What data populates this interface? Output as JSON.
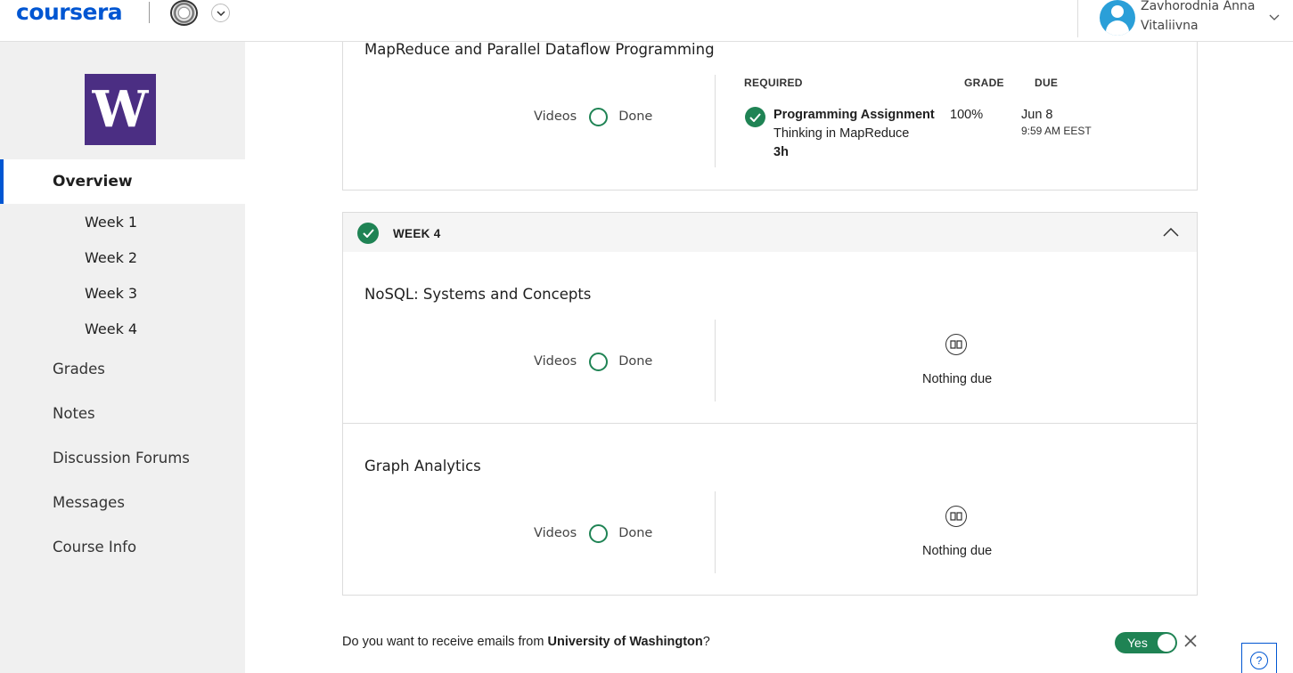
{
  "header": {
    "logo_text": "coursera",
    "user_name_line1": "Zavhorodnia Anna",
    "user_name_line2": "Vitaliivna"
  },
  "sidebar": {
    "logo_letter": "W",
    "overview": "Overview",
    "weeks": [
      "Week 1",
      "Week 2",
      "Week 3",
      "Week 4"
    ],
    "items": [
      "Grades",
      "Notes",
      "Discussion Forums",
      "Messages",
      "Course Info"
    ]
  },
  "week3_card": {
    "section_title": "MapReduce and Parallel Dataflow Programming",
    "videos_label": "Videos",
    "done_label": "Done",
    "col_required": "REQUIRED",
    "col_grade": "GRADE",
    "col_due": "DUE",
    "assignment": {
      "type": "Programming Assignment",
      "name": "Thinking in MapReduce",
      "duration": "3h",
      "grade": "100%",
      "due_date": "Jun 8",
      "due_time": "9:59 AM EEST"
    }
  },
  "week4_card": {
    "label": "WEEK 4",
    "sections": [
      {
        "title": "NoSQL: Systems and Concepts",
        "videos_label": "Videos",
        "done_label": "Done",
        "nothing_due": "Nothing due"
      },
      {
        "title": "Graph Analytics",
        "videos_label": "Videos",
        "done_label": "Done",
        "nothing_due": "Nothing due"
      }
    ]
  },
  "email_prompt": {
    "prefix": "Do you want to receive emails from ",
    "org": "University of Washington",
    "suffix": "?",
    "toggle_label": "Yes"
  },
  "help": {
    "label": "?"
  },
  "colors": {
    "brand": "#0056d2",
    "success": "#1f8354",
    "uw_purple": "#4b2e83"
  }
}
